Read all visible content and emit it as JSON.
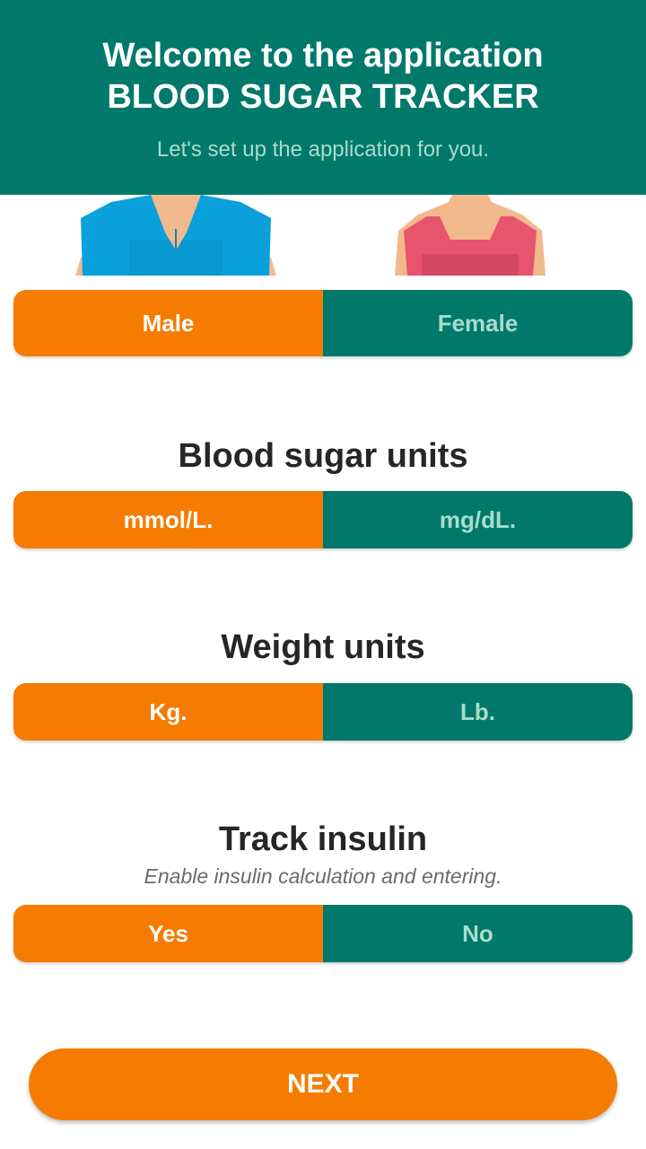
{
  "header": {
    "title_line1": "Welcome to the application",
    "title_line2": "BLOOD SUGAR TRACKER",
    "subtitle": "Let's set up the application for you."
  },
  "colors": {
    "primary_teal": "#00796b",
    "accent_orange": "#f57c00",
    "unselected_text": "#a8dccd",
    "heading_text": "#262626"
  },
  "gender": {
    "options": [
      "Male",
      "Female"
    ],
    "selected": "Male",
    "icons": [
      "male-avatar-icon",
      "female-avatar-icon"
    ]
  },
  "blood_sugar_units": {
    "title": "Blood sugar units",
    "options": [
      "mmol/L.",
      "mg/dL."
    ],
    "selected": "mmol/L."
  },
  "weight_units": {
    "title": "Weight units",
    "options": [
      "Kg.",
      "Lb."
    ],
    "selected": "Kg."
  },
  "track_insulin": {
    "title": "Track insulin",
    "description": "Enable insulin calculation and entering.",
    "options": [
      "Yes",
      "No"
    ],
    "selected": "Yes"
  },
  "next_button": {
    "label": "NEXT"
  }
}
